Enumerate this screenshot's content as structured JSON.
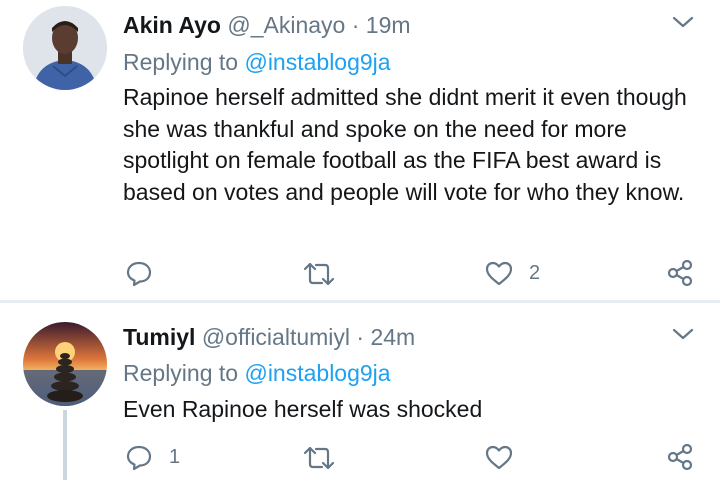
{
  "tweets": [
    {
      "display_name": "Akin Ayo",
      "handle": "@_Akinayo",
      "separator": "·",
      "time": "19m",
      "replying_prefix": "Replying to",
      "replying_to": "@instablog9ja",
      "text": "Rapinoe herself admitted she didnt merit it even though she was thankful and spoke on the need for more spotlight on female football as the FIFA best award is based on votes and people will vote for who they know.",
      "reply_count": "",
      "retweet_count": "",
      "like_count": "2"
    },
    {
      "display_name": "Tumiyl",
      "handle": "@officialtumiyl",
      "separator": "·",
      "time": "24m",
      "replying_prefix": "Replying to",
      "replying_to": "@instablog9ja",
      "text": "Even Rapinoe herself was shocked",
      "reply_count": "1",
      "retweet_count": "",
      "like_count": ""
    }
  ],
  "colors": {
    "accent": "#1da1f2",
    "secondary_text": "#657786",
    "divider": "#e6ecf0"
  },
  "icons": [
    "avatar",
    "chevron-down-icon",
    "reply-icon",
    "retweet-icon",
    "like-icon",
    "share-icon"
  ]
}
